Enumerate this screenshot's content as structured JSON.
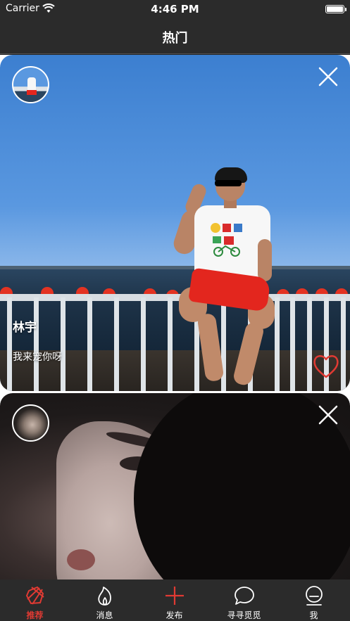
{
  "status_bar": {
    "carrier": "Carrier",
    "time": "4:46 PM"
  },
  "nav": {
    "title": "热门"
  },
  "feed": {
    "cards": [
      {
        "name": "林宇",
        "bio": "我来宠你呀"
      },
      {
        "name": "",
        "bio": ""
      }
    ]
  },
  "tab_bar": {
    "tabs": [
      {
        "label": "推荐",
        "icon": "aperture-icon",
        "active": true
      },
      {
        "label": "消息",
        "icon": "flame-icon",
        "active": false
      },
      {
        "label": "发布",
        "icon": "plus-icon",
        "active": false
      },
      {
        "label": "寻寻觅觅",
        "icon": "chat-bubble-icon",
        "active": false
      },
      {
        "label": "我",
        "icon": "profile-icon",
        "active": false
      }
    ]
  },
  "colors": {
    "accent": "#e03a33",
    "bar_bg": "#2b2b2b",
    "like": "#e03a33"
  }
}
